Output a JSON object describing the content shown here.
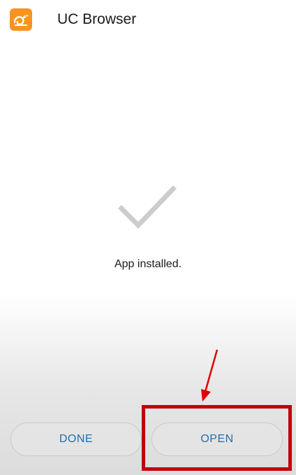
{
  "header": {
    "app_name": "UC Browser",
    "app_icon": "uc-browser-squirrel-icon",
    "icon_color": "#f7931e"
  },
  "main": {
    "status_icon": "check-icon",
    "status_text": "App installed."
  },
  "actions": {
    "done_label": "DONE",
    "open_label": "OPEN",
    "accent_color": "#1f6fb0"
  },
  "annotation": {
    "highlight_color": "#c0000a",
    "arrow_icon": "arrow-pointer"
  }
}
